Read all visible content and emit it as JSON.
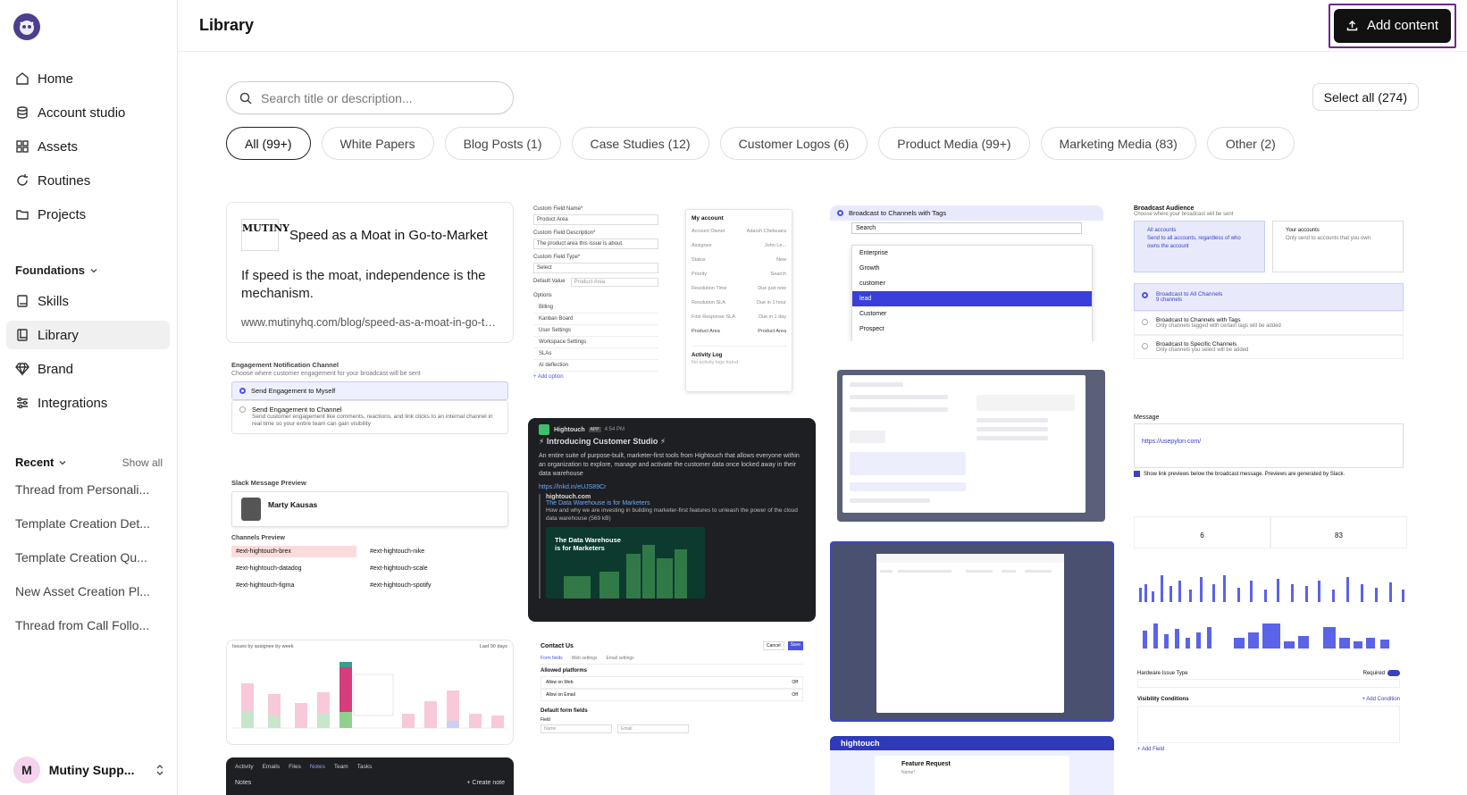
{
  "sidebar": {
    "nav": [
      {
        "label": "Home",
        "icon": "home-icon"
      },
      {
        "label": "Account studio",
        "icon": "database-icon"
      },
      {
        "label": "Assets",
        "icon": "grid-icon"
      },
      {
        "label": "Routines",
        "icon": "refresh-icon"
      },
      {
        "label": "Projects",
        "icon": "folder-icon"
      }
    ],
    "foundations_label": "Foundations",
    "foundations": [
      {
        "label": "Skills",
        "icon": "book-icon"
      },
      {
        "label": "Library",
        "icon": "library-icon",
        "active": true
      },
      {
        "label": "Brand",
        "icon": "gem-icon"
      },
      {
        "label": "Integrations",
        "icon": "sliders-icon"
      }
    ],
    "recent_label": "Recent",
    "show_all": "Show all",
    "recent": [
      "Thread from Personali...",
      "Template Creation Det...",
      "Template Creation Qu...",
      "New Asset Creation Pl...",
      "Thread from Call Follo..."
    ],
    "user": {
      "initial": "M",
      "name": "Mutiny Supp..."
    }
  },
  "header": {
    "title": "Library",
    "add_button": "Add content"
  },
  "search": {
    "placeholder": "Search title or description..."
  },
  "select_all": "Select all (274)",
  "filters": [
    {
      "label": "All (99+)",
      "active": true
    },
    {
      "label": "White Papers"
    },
    {
      "label": "Blog Posts (1)"
    },
    {
      "label": "Case Studies (12)"
    },
    {
      "label": "Customer Logos (6)"
    },
    {
      "label": "Product Media (99+)"
    },
    {
      "label": "Marketing Media (83)"
    },
    {
      "label": "Other (2)"
    }
  ],
  "cards": {
    "blog": {
      "logo_text": "MUTINY",
      "title": "Speed as a Moat in Go-to-Market",
      "description": "If speed is the moat, independence is the mechanism.",
      "url": "www.mutinyhq.com/blog/speed-as-a-moat-in-go-to-market"
    },
    "engagement": {
      "heading": "Engagement Notification Channel",
      "sub": "Choose where customer engagement for your broadcast will be sent",
      "opt1": "Send Engagement to Myself",
      "opt2": "Send Engagement to Channel",
      "opt2_desc": "Send customer engagement like comments, reactions, and link clicks to an internal channel in real time so your entire team can gain visibility"
    },
    "slack_preview": {
      "heading": "Slack Message Preview",
      "person": "Marty Kausas",
      "channels_heading": "Channels Preview",
      "channels": [
        "#ext-hightouch-brex",
        "#ext-hightouch-nike",
        "#ext-hightouch-datadog",
        "#ext-hightouch-scale",
        "#ext-hightouch-figma",
        "#ext-hightouch-spotify"
      ]
    },
    "custom_field": {
      "name_label": "Custom Field Name*",
      "name_value": "Product Area",
      "desc_label": "Custom Field Description*",
      "desc_value": "The product area this issue is about.",
      "type_label": "Custom Field Type*",
      "type_value": "Select",
      "default_label": "Default Value",
      "default_value": "Product Area",
      "options_label": "Options",
      "options": [
        "Billing",
        "Kanban Board",
        "User Settings",
        "Workspace Settings",
        "SLAs",
        "AI deflection"
      ],
      "add_option": "+ Add option"
    },
    "account_panel": {
      "title": "My account",
      "rows": [
        {
          "k": "Account Owner",
          "v": "Adarsh Chetsuara"
        },
        {
          "k": "Assignee",
          "v": "John Le..."
        },
        {
          "k": "Status",
          "v": "New"
        },
        {
          "k": "Priority",
          "v": "Search"
        },
        {
          "k": "Resolution Time",
          "v": "Due just now"
        },
        {
          "k": "Resolution SLA",
          "v": "Due in 1 hour"
        },
        {
          "k": "First Response SLA",
          "v": "Due in 1 day"
        },
        {
          "k": "Product Area",
          "v": "Product Area"
        }
      ],
      "activity": "Activity Log",
      "activity_sub": "No activity logs found"
    },
    "hightouch_post": {
      "author": "Hightouch",
      "tag": "APP",
      "time": "4:54 PM",
      "headline": "⚡ Introducing Customer Studio ⚡",
      "body": "An entire suite of purpose-built, marketer-first tools from Hightouch that allows everyone within an organization to explore, manage and activate the customer data once locked away in their data warehouse",
      "link": "https://lnkd.in/eUJS89Cr",
      "site": "hightouch.com",
      "link_title": "The Data Warehouse is for Marketers",
      "link_desc": "How and why we are investing in building marketer-first features to unleash the power of the cloud data warehouse (569 kB)",
      "image_title": "The Data Warehouse is for Marketers"
    },
    "tags_dropdown": {
      "heading": "Broadcast to Channels with Tags",
      "search": "Search",
      "options": [
        "Enterprise",
        "Growth",
        "customer",
        "lead",
        "Customer",
        "Prospect"
      ],
      "selected": "lead"
    },
    "broadcast_audience": {
      "heading": "Broadcast Audience",
      "sub": "Choose where your broadcast will be sent",
      "all_title": "All accounts",
      "all_desc": "Send to all accounts, regardless of who owns the account",
      "yours_title": "Your accounts",
      "yours_desc": "Only send to accounts that you own",
      "opt1": "Broadcast to All Channels",
      "opt1_sub": "9 channels",
      "opt2": "Broadcast to Channels with Tags",
      "opt2_sub": "Only channels tagged with certain tags will be added",
      "opt3": "Broadcast to Specific Channels",
      "opt3_sub": "Only channels you select will be added"
    },
    "message": {
      "heading": "Message",
      "link": "https://usepylon.com/",
      "checkbox": "Show link previews below the broadcast message. Previews are generated by Slack."
    },
    "stats": {
      "a": "6",
      "b": "83"
    },
    "issues_chart": {
      "title": "Issues by assignee by week",
      "range": "Last 90 days"
    },
    "contact_us": {
      "title": "Contact Us",
      "cancel": "Cancel",
      "save": "Save",
      "tabs": [
        "Form fields",
        "Web settings",
        "Email settings"
      ],
      "allowed": "Allowed platforms",
      "allow_web": "Allow on Web",
      "allow_email": "Allow on Email",
      "toggle_state": "Off",
      "default_fields": "Default form fields",
      "field_label": "Field",
      "name": "Name",
      "email": "Email"
    },
    "activity_bar": {
      "tabs": [
        "Activity",
        "Emails",
        "Files",
        "Notes",
        "Team",
        "Tasks"
      ],
      "notes": "Notes",
      "create": "+ Create note"
    },
    "hightouch_request": {
      "brand": "hightouch",
      "title": "Feature Request",
      "field": "Name*"
    },
    "visibility": {
      "field": "Hardware Issue Type",
      "required": "Required",
      "conditions": "Visibility Conditions",
      "add_condition": "+ Add Condition",
      "add_field": "+ Add Field"
    }
  }
}
